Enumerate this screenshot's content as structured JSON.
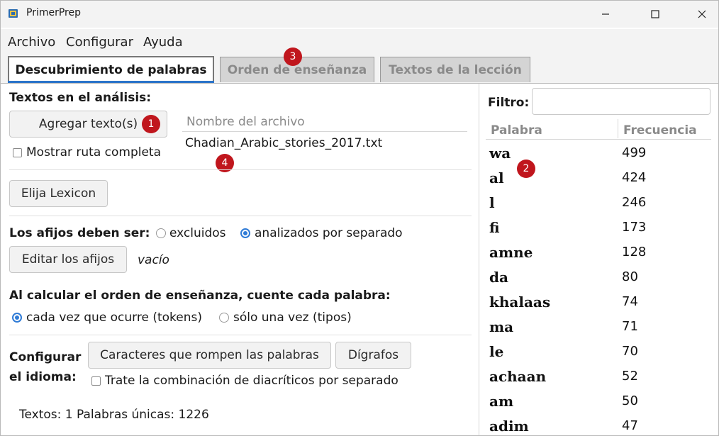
{
  "window": {
    "title": "PrimerPrep"
  },
  "menu": [
    "Archivo",
    "Configurar",
    "Ayuda"
  ],
  "tabs": [
    {
      "label": "Descubrimiento de palabras",
      "active": true
    },
    {
      "label": "Orden de enseñanza",
      "active": false
    },
    {
      "label": "Textos de la lección",
      "active": false
    }
  ],
  "left": {
    "texts_heading": "Textos en el análisis:",
    "add_texts_button": "Agregar texto(s)",
    "show_path_checkbox": "Mostrar ruta completa",
    "file_column_header": "Nombre del archivo",
    "files": [
      "Chadian_Arabic_stories_2017.txt"
    ],
    "lexicon_button": "Elija Lexicon",
    "affixes_label": "Los afijos deben ser:",
    "affix_option_excluded": "excluidos",
    "affix_option_separate": "analizados por separado",
    "affix_selected": "analizados por separado",
    "edit_affixes_button": "Editar los afijos",
    "affixes_status": "vacío",
    "count_heading": "Al calcular el orden de enseñanza, cuente cada palabra:",
    "count_option_tokens": "cada vez que ocurre (tokens)",
    "count_option_types": "sólo una vez (tipos)",
    "count_selected": "cada vez que ocurre (tokens)",
    "config_label_line1": "Configurar",
    "config_label_line2": "el idioma:",
    "word_breaking_button": "Caracteres que rompen las palabras",
    "digraphs_button": "Dígrafos",
    "diacritics_checkbox": "Trate la combinación de diacríticos por separado",
    "status": "Textos: 1  Palabras únicas: 1226"
  },
  "right": {
    "filter_label": "Filtro:",
    "filter_value": "",
    "columns": [
      "Palabra",
      "Frecuencia"
    ],
    "rows": [
      {
        "word": "wa",
        "freq": "499"
      },
      {
        "word": "al",
        "freq": "424"
      },
      {
        "word": "l",
        "freq": "246"
      },
      {
        "word": "fi",
        "freq": "173"
      },
      {
        "word": "amne",
        "freq": "128"
      },
      {
        "word": "da",
        "freq": "80"
      },
      {
        "word": "khalaas",
        "freq": "74"
      },
      {
        "word": "ma",
        "freq": "71"
      },
      {
        "word": "le",
        "freq": "70"
      },
      {
        "word": "achaan",
        "freq": "52"
      },
      {
        "word": "am",
        "freq": "50"
      },
      {
        "word": "adim",
        "freq": "47"
      }
    ]
  },
  "markers": [
    "1",
    "2",
    "3",
    "4"
  ],
  "colors": {
    "accent": "#2a73c9",
    "marker": "#c0161d",
    "radio": "#2f7bd6"
  },
  "icons": [
    "app-icon",
    "minimize-icon",
    "maximize-icon",
    "close-icon"
  ]
}
